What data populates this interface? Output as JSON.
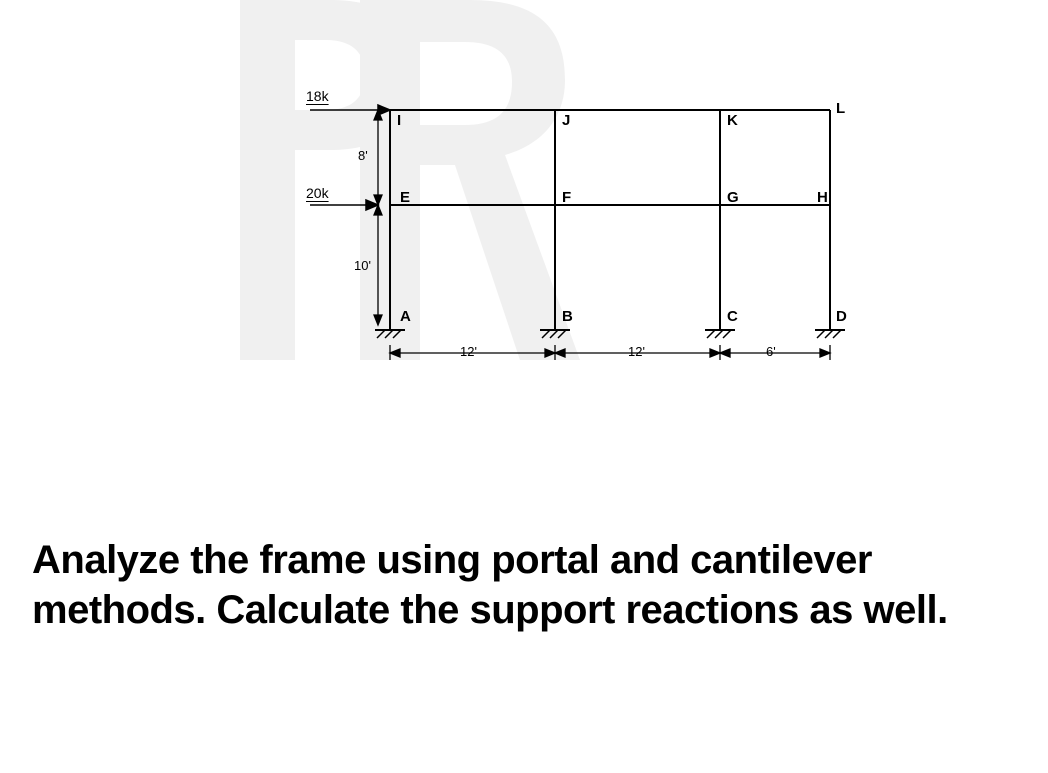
{
  "loads": {
    "top": "18k",
    "mid": "20k"
  },
  "heights": {
    "upper": "8'",
    "lower": "10'"
  },
  "widths": {
    "span1": "12'",
    "span2": "12'",
    "span3": "6'"
  },
  "nodes": {
    "A": "A",
    "B": "B",
    "C": "C",
    "D": "D",
    "E": "E",
    "F": "F",
    "G": "G",
    "H": "H",
    "I": "I",
    "J": "J",
    "K": "K",
    "L": "L"
  },
  "question": "Analyze the frame using portal and cantilever methods. Calculate the support reactions as well."
}
